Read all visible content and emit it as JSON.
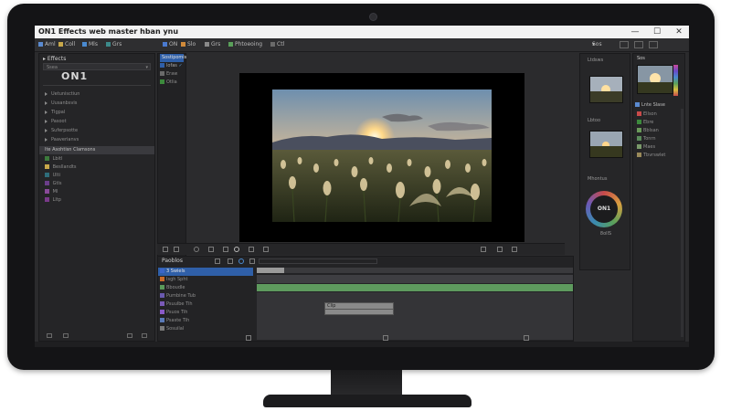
{
  "window": {
    "title": "ON1 Effects  web master hban ynu",
    "min": "—",
    "max": "☐",
    "close": "✕"
  },
  "menubar": {
    "items": [
      "Aml",
      "Coll",
      "Mls",
      "Grs"
    ],
    "items2": [
      "ON",
      "Slo",
      "Grs",
      "Phtoeoing",
      "Ctl"
    ],
    "right": "Sos"
  },
  "left_panel": {
    "title": "Effects",
    "brand": "ON1",
    "search_placeholder": "Ssea",
    "rows": [
      "Uetunisctiun",
      "Uusanbsvis",
      "Tlgpal",
      "Pasoot",
      "Suferpsotte",
      "Paaverianvs"
    ],
    "highlight_row": "Ite Asohtisn Clamsons",
    "color_rows": [
      "Lbitl",
      "Besllandts",
      "Ulti",
      "Gtls",
      "Ml",
      "Lltp"
    ],
    "colors": [
      "#3c7a3c",
      "#c8a84a",
      "#2e6d7a",
      "#6b3e8a",
      "#8a4a9a",
      "#7a3a8a"
    ]
  },
  "mid_panel": {
    "items": [
      "Sostipomis",
      "lofas",
      "Eraw",
      "Otlia"
    ]
  },
  "timeline": {
    "title": "Paoblos",
    "tracks": [
      "3 Swiels",
      "Isgh Spht",
      "Bboudle",
      "Pumbine Tub",
      "Psuulbe Tih",
      "Psuos Tih",
      "Psaste Tih",
      "Sosuilal"
    ],
    "track_colors": [
      "#3a66c8",
      "#c86a2a",
      "#5a9a5a",
      "#6a5ab0",
      "#7a5ab8",
      "#8a5ac8",
      "#5a7ab8",
      "#7a7a7a"
    ],
    "clip_label": "Clip"
  },
  "right_panel": {
    "header": "Sos",
    "sections": [
      "Ltdsws",
      "Lbtoo",
      "Mhontus"
    ],
    "layer_title": "Lnte Slase",
    "layers": [
      "Ellson",
      "Ebre",
      "Bblsan",
      "Tonrn",
      "Maes",
      "Tbvrswlet"
    ],
    "layer_colors": [
      "#c84a4a",
      "#3c8a3c",
      "#6a9a5a",
      "#5a8a5a",
      "#7a9a6a",
      "#9a8a5a"
    ],
    "dial_label": "ON1",
    "dial_value": "8ollS"
  },
  "colors": {
    "accent_blue": "#2f5fa8",
    "track_green": "#5e9a5e"
  }
}
